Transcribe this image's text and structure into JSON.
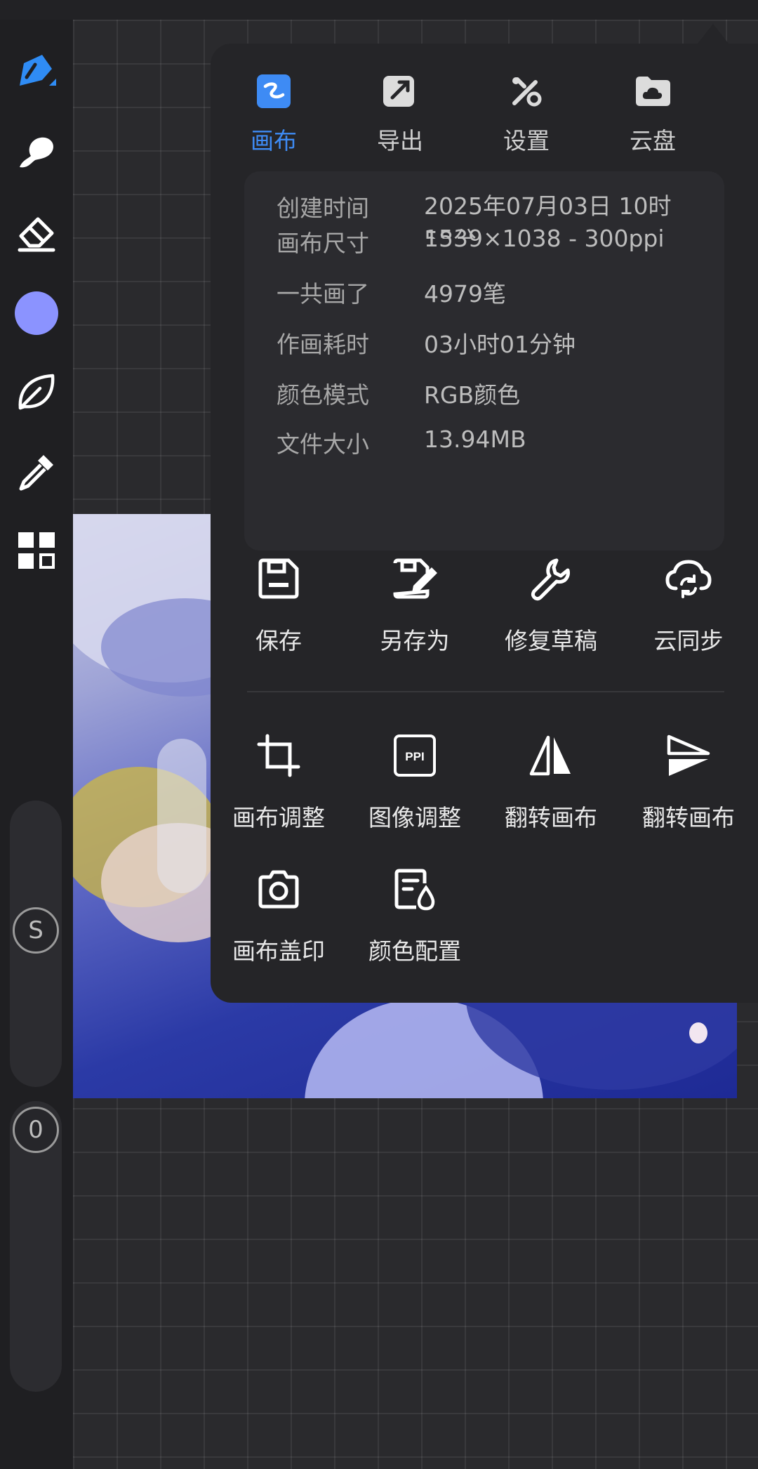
{
  "colors": {
    "accent": "#3e8bf4",
    "current_brush_color": "#8b93ff",
    "panel_bg": "#252528"
  },
  "toolbar": {
    "tools": [
      {
        "name": "brush-tool",
        "icon": "brush-icon",
        "active": true
      },
      {
        "name": "smudge-tool",
        "icon": "smudge-icon"
      },
      {
        "name": "eraser-tool",
        "icon": "eraser-icon"
      },
      {
        "name": "color-picker",
        "icon": "color-swatch"
      },
      {
        "name": "lasso-tool",
        "icon": "leaf-icon"
      },
      {
        "name": "eyedropper-tool",
        "icon": "eyedropper-icon"
      },
      {
        "name": "layers-tool",
        "icon": "grid-icon"
      }
    ],
    "size_slider": {
      "label": "S"
    },
    "opacity_slider": {
      "label": "0"
    }
  },
  "panel": {
    "tabs": [
      {
        "label": "画布",
        "icon": "canvas-icon",
        "active": true
      },
      {
        "label": "导出",
        "icon": "export-icon"
      },
      {
        "label": "设置",
        "icon": "settings-icon"
      },
      {
        "label": "云盘",
        "icon": "cloud-drive-icon"
      }
    ],
    "info": [
      {
        "key": "创建时间",
        "value": "2025年07月03日 10时58分"
      },
      {
        "key": "画布尺寸",
        "value": "1539×1038 - 300ppi"
      },
      {
        "key": "一共画了",
        "value": "4979笔"
      },
      {
        "key": "作画耗时",
        "value": "03小时01分钟"
      },
      {
        "key": "颜色模式",
        "value": "RGB颜色"
      },
      {
        "key": "文件大小",
        "value": "13.94MB"
      }
    ],
    "actions_row1": [
      {
        "label": "保存",
        "icon": "save-icon"
      },
      {
        "label": "另存为",
        "icon": "save-as-icon"
      },
      {
        "label": "修复草稿",
        "icon": "wrench-icon"
      },
      {
        "label": "云同步",
        "icon": "cloud-sync-icon"
      }
    ],
    "actions_row2": [
      {
        "label": "画布调整",
        "icon": "crop-icon"
      },
      {
        "label": "图像调整",
        "icon": "ppi-icon"
      },
      {
        "label": "翻转画布",
        "icon": "flip-horizontal-icon"
      },
      {
        "label": "翻转画布",
        "icon": "flip-vertical-icon"
      }
    ],
    "actions_row3": [
      {
        "label": "画布盖印",
        "icon": "camera-icon"
      },
      {
        "label": "颜色配置",
        "icon": "color-profile-icon"
      }
    ]
  }
}
